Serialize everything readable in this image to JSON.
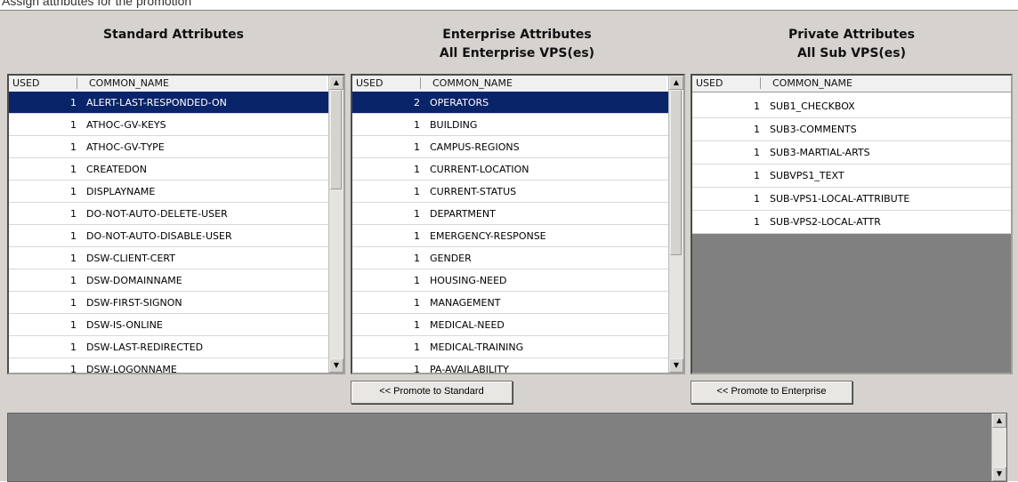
{
  "caption": "Assign attributes for the promotion",
  "panels": {
    "standard": {
      "title": "Standard Attributes",
      "subtitle": ""
    },
    "enterprise": {
      "title": "Enterprise Attributes",
      "subtitle": "All Enterprise VPS(es)"
    },
    "private": {
      "title": "Private Attributes",
      "subtitle": "All Sub VPS(es)"
    }
  },
  "columns": {
    "used": "USED",
    "name": "COMMON_NAME"
  },
  "standard_rows": [
    {
      "used": "1",
      "name": "ALERT-LAST-RESPONDED-ON"
    },
    {
      "used": "1",
      "name": "ATHOC-GV-KEYS"
    },
    {
      "used": "1",
      "name": "ATHOC-GV-TYPE"
    },
    {
      "used": "1",
      "name": "CREATEDON"
    },
    {
      "used": "1",
      "name": "DISPLAYNAME"
    },
    {
      "used": "1",
      "name": "DO-NOT-AUTO-DELETE-USER"
    },
    {
      "used": "1",
      "name": "DO-NOT-AUTO-DISABLE-USER"
    },
    {
      "used": "1",
      "name": "DSW-CLIENT-CERT"
    },
    {
      "used": "1",
      "name": "DSW-DOMAINNAME"
    },
    {
      "used": "1",
      "name": "DSW-FIRST-SIGNON"
    },
    {
      "used": "1",
      "name": "DSW-IS-ONLINE"
    },
    {
      "used": "1",
      "name": "DSW-LAST-REDIRECTED"
    },
    {
      "used": "1",
      "name": "DSW-LOGONNAME"
    }
  ],
  "enterprise_rows": [
    {
      "used": "2",
      "name": "OPERATORS"
    },
    {
      "used": "1",
      "name": "BUILDING"
    },
    {
      "used": "1",
      "name": "CAMPUS-REGIONS"
    },
    {
      "used": "1",
      "name": "CURRENT-LOCATION"
    },
    {
      "used": "1",
      "name": "CURRENT-STATUS"
    },
    {
      "used": "1",
      "name": "DEPARTMENT"
    },
    {
      "used": "1",
      "name": "EMERGENCY-RESPONSE"
    },
    {
      "used": "1",
      "name": "GENDER"
    },
    {
      "used": "1",
      "name": "HOUSING-NEED"
    },
    {
      "used": "1",
      "name": "MANAGEMENT"
    },
    {
      "used": "1",
      "name": "MEDICAL-NEED"
    },
    {
      "used": "1",
      "name": "MEDICAL-TRAINING"
    },
    {
      "used": "1",
      "name": "PA-AVAILABILITY"
    }
  ],
  "private_rows": [
    {
      "used": "1",
      "name": "SUB1_CHECKBOX"
    },
    {
      "used": "1",
      "name": "SUB3-COMMENTS"
    },
    {
      "used": "1",
      "name": "SUB3-MARTIAL-ARTS"
    },
    {
      "used": "1",
      "name": "SUBVPS1_TEXT"
    },
    {
      "used": "1",
      "name": "SUB-VPS1-LOCAL-ATTRIBUTE"
    },
    {
      "used": "1",
      "name": "SUB-VPS2-LOCAL-ATTR"
    }
  ],
  "buttons": {
    "promote_standard": "<< Promote to Standard",
    "promote_enterprise": "<< Promote to Enterprise"
  },
  "icons": {
    "scroll_up": "scroll-up-arrow-icon",
    "scroll_down": "scroll-down-arrow-icon"
  },
  "colors": {
    "selection": "#0a246a",
    "window": "#d6d3ce",
    "empty_area": "#808080"
  }
}
